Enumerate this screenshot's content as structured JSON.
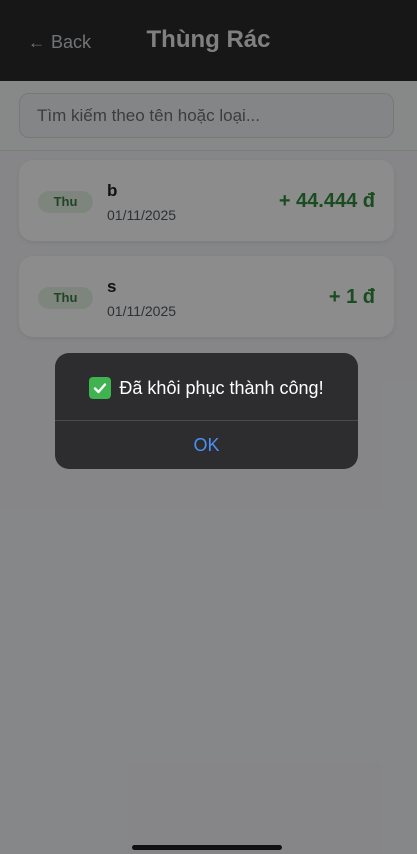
{
  "header": {
    "back_label": "Back",
    "title": "Thùng Rác"
  },
  "search": {
    "placeholder": "Tìm kiếm theo tên hoặc loại..."
  },
  "items": [
    {
      "badge": "Thu",
      "name": "b",
      "date": "01/11/2025",
      "amount": "+ 44.444 đ"
    },
    {
      "badge": "Thu",
      "name": "s",
      "date": "01/11/2025",
      "amount": "+ 1 đ"
    }
  ],
  "alert": {
    "icon": "check-icon",
    "message": "Đã khôi phục thành công!",
    "ok_label": "OK"
  },
  "colors": {
    "header_bg": "#2b2b2d",
    "income_green": "#2f8a3c",
    "badge_bg": "#e3f3e4",
    "alert_bg": "#2d2d2f",
    "ok_blue": "#4d8ff0"
  }
}
